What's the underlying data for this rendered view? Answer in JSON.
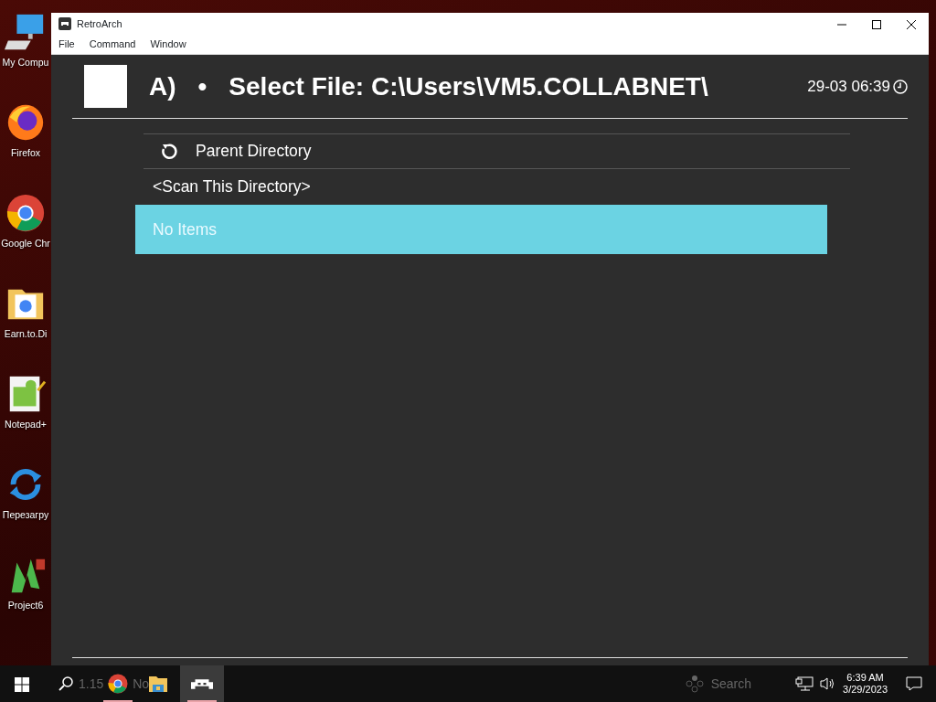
{
  "desktop_icons": [
    {
      "label": "My Compu",
      "kind": "computer"
    },
    {
      "label": "Firefox",
      "kind": "firefox"
    },
    {
      "label": "Google Chr",
      "kind": "chrome"
    },
    {
      "label": "Earn.to.Di",
      "kind": "folder"
    },
    {
      "label": "Notepad+",
      "kind": "notepad"
    },
    {
      "label": "Перезагру",
      "kind": "refresh"
    },
    {
      "label": "Project6",
      "kind": "project"
    }
  ],
  "window": {
    "title": "RetroArch",
    "menu": [
      "File",
      "Command",
      "Window"
    ]
  },
  "header": {
    "index": "A)",
    "bullet": "•",
    "title": "Select File: C:\\Users\\VM5.COLLABNET\\",
    "clock": "29-03 06:39"
  },
  "entries": [
    {
      "label": "Parent Directory",
      "kind": "parent",
      "selected": false
    },
    {
      "label": "<Scan This Directory>",
      "kind": "plain",
      "selected": false
    },
    {
      "label": "No Items",
      "kind": "plain",
      "selected": true
    }
  ],
  "footer": {
    "version": "1.15",
    "core": "No",
    "hints": [
      "Search"
    ]
  },
  "taskbar": {
    "apps": [
      {
        "kind": "chrome",
        "running": true,
        "active": false
      },
      {
        "kind": "folder",
        "running": false,
        "active": false
      },
      {
        "kind": "retroarch",
        "running": true,
        "active": true
      }
    ],
    "time": "6:39 AM",
    "date": "3/29/2023"
  }
}
